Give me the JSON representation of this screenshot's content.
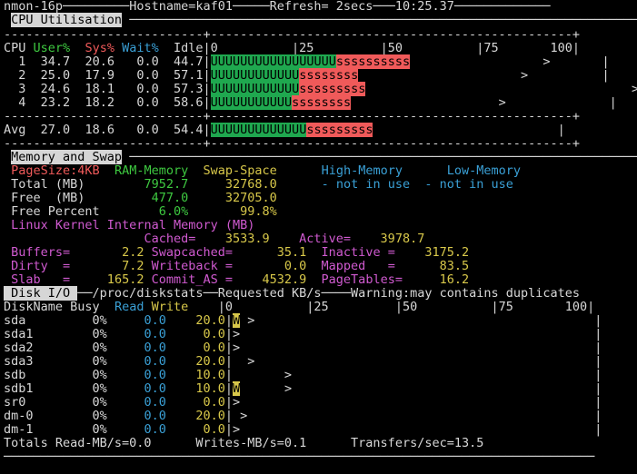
{
  "title_bar": {
    "prefix": "nmon-16p",
    "hostname": "Hostname=kaf01",
    "refresh": "Refresh= 2secs",
    "time": "10:25.37"
  },
  "cpu": {
    "section_title": "CPU Utilisation",
    "separator": "---------------------------+-------------------------------------------------+",
    "headers": {
      "cpu": "CPU",
      "user": "User%",
      "sys": "Sys%",
      "wait": "Wait%",
      "idle": "Idle"
    },
    "scale": "|0          |25         |50          |75       100|",
    "rows": [
      {
        "id": "1",
        "user": "34.7",
        "sys": "20.6",
        "wait": "0.0",
        "idle": "44.7",
        "bar_u": "UUUUUUUUUUUUUUUUU",
        "bar_s": "ssssssssss",
        "tail": "                  >       |"
      },
      {
        "id": "2",
        "user": "25.0",
        "sys": "17.9",
        "wait": "0.0",
        "idle": "57.1",
        "bar_u": "UUUUUUUUUUUU",
        "bar_s": "ssssssss",
        "tail": "                      >          |"
      },
      {
        "id": "3",
        "user": "24.6",
        "sys": "18.1",
        "wait": "0.0",
        "idle": "57.3",
        "bar_u": "UUUUUUUUUUUU",
        "bar_s": "sssssssss",
        "tail": "                                    >"
      },
      {
        "id": "4",
        "user": "23.2",
        "sys": "18.2",
        "wait": "0.0",
        "idle": "58.6",
        "bar_u": "UUUUUUUUUUU",
        "bar_s": "ssssssss",
        "tail": "                    >              |"
      }
    ],
    "avg": {
      "label": "Avg",
      "user": "27.0",
      "sys": "18.6",
      "wait": "0.0",
      "idle": "54.4",
      "bar_u": "UUUUUUUUUUUUU",
      "bar_s": "sssssssss",
      "tail": "                         |"
    }
  },
  "memory": {
    "section_title": "Memory and Swap",
    "header": {
      "pagesize": "PageSize:4KB",
      "ram": "RAM-Memory",
      "swap": "Swap-Space",
      "high": "High-Memory",
      "low": "Low-Memory"
    },
    "total": {
      "label": "Total (MB)",
      "ram": "7952.7",
      "swap": "32768.0",
      "high": "- not in use",
      "low": "- not in use"
    },
    "free": {
      "label": "Free  (MB)",
      "ram": "477.0",
      "swap": "32705.0"
    },
    "free_percent": {
      "label": "Free Percent",
      "ram": "6.0%",
      "swap": "99.8%"
    },
    "kernel_title": "Linux Kernel Internal Memory (MB)",
    "cached": {
      "label": "Cached=",
      "value": "3533.9",
      "label2": "Active=",
      "value2": "3978.7"
    },
    "buffers": {
      "label": "Buffers=",
      "value": "2.2",
      "label2": "Swapcached=",
      "value2": "35.1",
      "label3": "Inactive =",
      "value3": "3175.2"
    },
    "dirty": {
      "label": "Dirty  =",
      "value": "7.2",
      "label2": "Writeback =",
      "value2": "0.0",
      "label3": "Mapped   =",
      "value3": "83.5"
    },
    "slab": {
      "label": "Slab   =",
      "value": "165.2",
      "label2": "Commit_AS =",
      "value2": "4532.9",
      "label3": "PageTables=",
      "value3": "16.2"
    }
  },
  "disk": {
    "section_title": "Disk I/O",
    "source": "/proc/diskstats",
    "requested": "Requested KB/s",
    "warning": "Warning:may contains duplicates",
    "headers": {
      "name": "DiskName",
      "busy": "Busy",
      "read": "Read",
      "write": "Write"
    },
    "scale": "|0          |25         |50          |75       100|",
    "rows": [
      {
        "name": "sda",
        "busy": "0%",
        "read": "0.0",
        "write": "20.0",
        "bar": "W",
        "tail": " >                                              |"
      },
      {
        "name": "sda1",
        "busy": "0%",
        "read": "0.0",
        "write": "0.0",
        "bar": "",
        "tail": ">                                                |"
      },
      {
        "name": "sda2",
        "busy": "0%",
        "read": "0.0",
        "write": "0.0",
        "bar": "",
        "tail": ">                                                |"
      },
      {
        "name": "sda3",
        "busy": "0%",
        "read": "0.0",
        "write": "20.0",
        "bar": "",
        "tail": "  >                                              |"
      },
      {
        "name": "sdb",
        "busy": "0%",
        "read": "0.0",
        "write": "10.0",
        "bar": "",
        "tail": "       >                                         |"
      },
      {
        "name": "sdb1",
        "busy": "0%",
        "read": "0.0",
        "write": "10.0",
        "bar": "W",
        "tail": "      >                                         |"
      },
      {
        "name": "sr0",
        "busy": "0%",
        "read": "0.0",
        "write": "0.0",
        "bar": "",
        "tail": ">                                                |"
      },
      {
        "name": "dm-0",
        "busy": "0%",
        "read": "0.0",
        "write": "20.0",
        "bar": "",
        "tail": " >                                               |"
      },
      {
        "name": "dm-1",
        "busy": "0%",
        "read": "0.0",
        "write": "0.0",
        "bar": "",
        "tail": ">                                                |"
      }
    ],
    "totals": {
      "read": "Totals Read-MB/s=0.0",
      "write": "Writes-MB/s=0.1",
      "transfers": "Transfers/sec=13.5"
    }
  }
}
